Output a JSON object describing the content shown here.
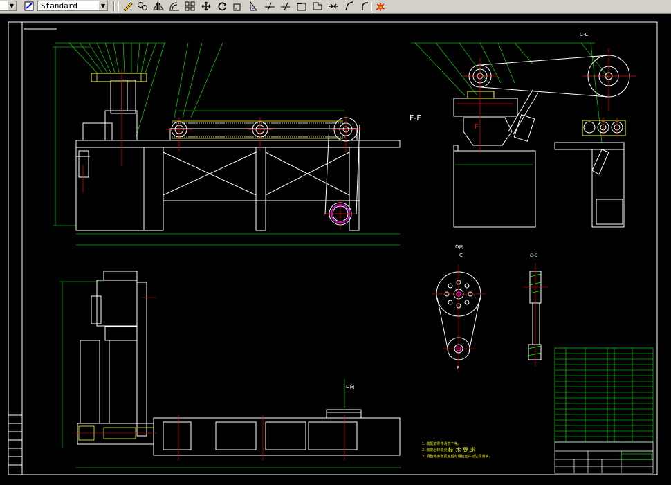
{
  "toolbar": {
    "text_style": "Standard",
    "icons": [
      "text-style-icon",
      "pencil-icon",
      "mirror-icon",
      "array-icon",
      "offset-icon",
      "move-icon",
      "rotate-icon",
      "scale-icon",
      "stretch-icon",
      "trim-icon",
      "extend-icon",
      "break-icon",
      "chamfer-icon",
      "join-icon",
      "fillet-icon",
      "explode-icon"
    ]
  },
  "drawing": {
    "view_ff": "F-F",
    "view_cc": "C-C",
    "view_cc_small": "C-C",
    "label_d": "D向",
    "label_d2": "D向",
    "label_c": "C",
    "label_e": "E",
    "label_f": "F",
    "notes_title": "技 术 要 求",
    "notes": [
      "1. 装配前零件清洗干净。",
      "2. 装配后转动灵活。",
      "3. 调整链条张紧度后定期检查并加注润滑油。"
    ]
  },
  "colors": {
    "background": "#000000",
    "line_white": "#ffffff",
    "line_green": "#00ff00",
    "line_red": "#ff0000",
    "line_yellow": "#ffff00",
    "line_magenta": "#ff00ff",
    "line_cyan": "#00ffff"
  }
}
